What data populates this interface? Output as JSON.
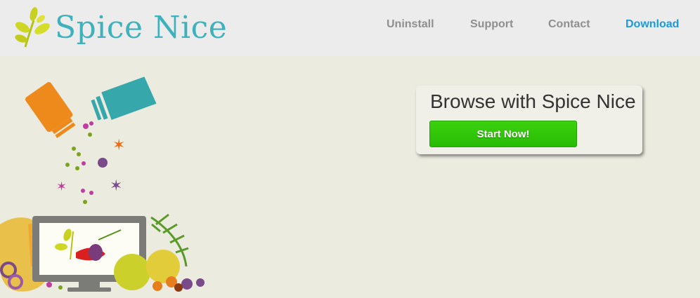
{
  "brand": {
    "name": "Spice Nice"
  },
  "nav": [
    {
      "label": "Uninstall",
      "active": false
    },
    {
      "label": "Support",
      "active": false
    },
    {
      "label": "Contact",
      "active": false
    },
    {
      "label": "Download",
      "active": true
    }
  ],
  "cta": {
    "title": "Browse with Spice Nice",
    "button_label": "Start Now!"
  },
  "colors": {
    "header_bg": "#ececec",
    "page_bg": "#ecebe0",
    "brand_teal": "#3fb1bd",
    "nav_gray": "#8f8f8f",
    "nav_active": "#1a9ae0",
    "button_green": "#33c90b"
  }
}
